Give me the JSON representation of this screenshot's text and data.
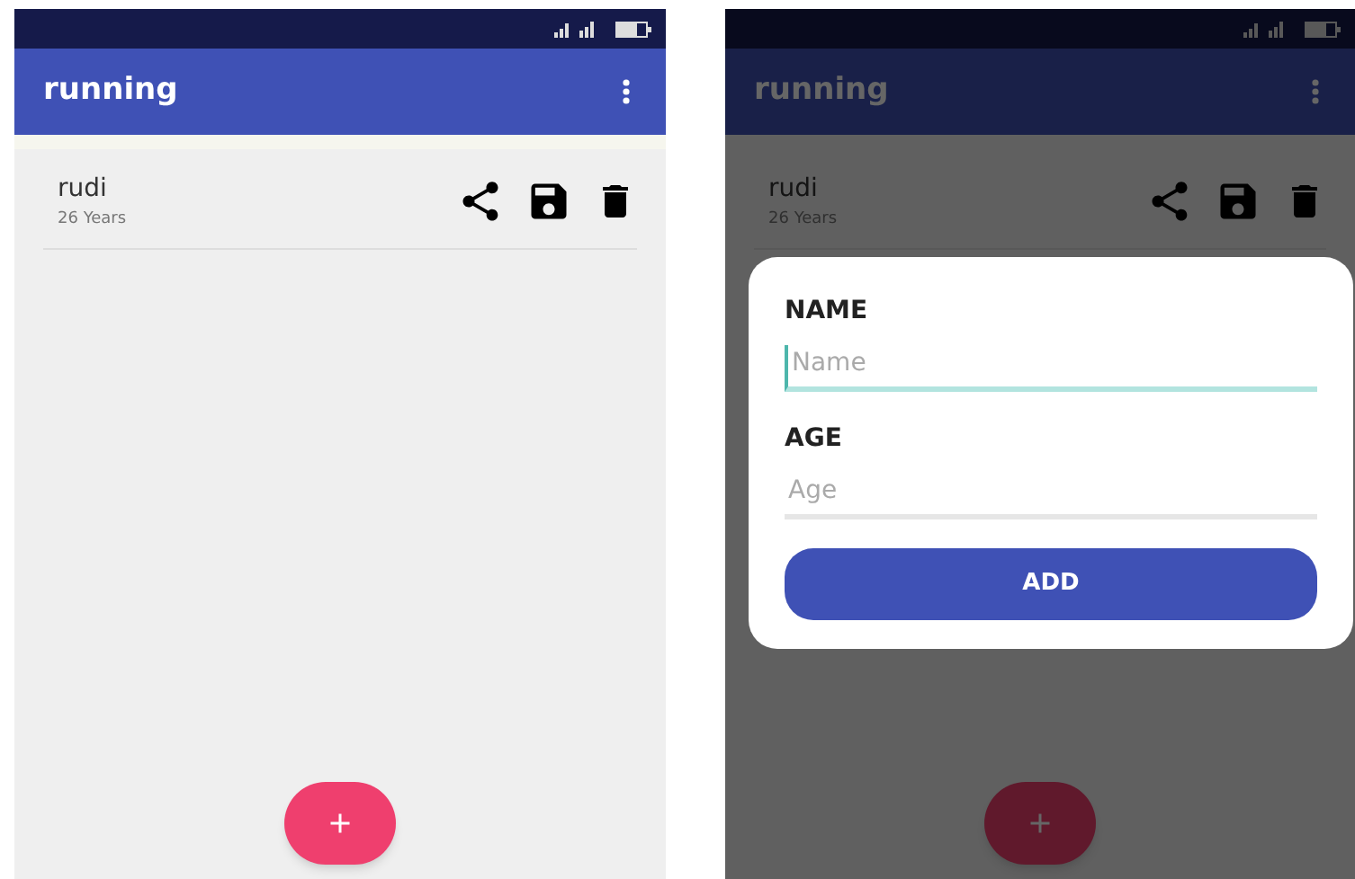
{
  "screens": [
    {
      "app_bar": {
        "title": "running"
      },
      "items": [
        {
          "name": "rudi",
          "age": "26 Years"
        }
      ]
    },
    {
      "app_bar": {
        "title": "running"
      },
      "items": [
        {
          "name": "rudi",
          "age": "26 Years"
        }
      ],
      "dialog": {
        "fields": [
          {
            "label": "NAME",
            "placeholder": "Name",
            "focused": true
          },
          {
            "label": "AGE",
            "placeholder": "Age",
            "focused": false
          }
        ],
        "button": "ADD"
      }
    }
  ]
}
